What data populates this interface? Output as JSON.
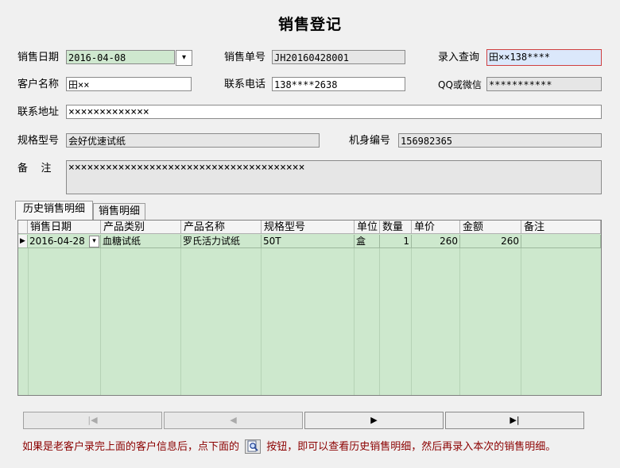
{
  "title": "销售登记",
  "form": {
    "sale_date": {
      "label": "销售日期",
      "value": "2016-04-08"
    },
    "sale_no": {
      "label": "销售单号",
      "value": "JH20160428001"
    },
    "lookup": {
      "label": "录入查询",
      "value": "田××138****"
    },
    "customer": {
      "label": "客户名称",
      "value": "田××"
    },
    "phone": {
      "label": "联系电话",
      "value": "138****2638"
    },
    "qq": {
      "label": "QQ或微信",
      "value": "***********"
    },
    "address": {
      "label": "联系地址",
      "value": "×××××××××××××"
    },
    "model": {
      "label": "规格型号",
      "value": "会好优速试纸"
    },
    "serial": {
      "label": "机身编号",
      "value": "156982365"
    },
    "note": {
      "label": "备    注",
      "value": "××××××××××××××××××××××××××××××××××××××"
    }
  },
  "tabs": [
    {
      "label": "历史销售明细",
      "active": true
    },
    {
      "label": "销售明细",
      "active": false
    }
  ],
  "grid": {
    "columns": [
      "销售日期",
      "产品类别",
      "产品名称",
      "规格型号",
      "单位",
      "数量",
      "单价",
      "金额",
      "备注"
    ],
    "rows": [
      {
        "date": "2016-04-28",
        "category": "血糖试纸",
        "product": "罗氏活力试纸",
        "spec": "50T",
        "unit": "盒",
        "qty": "1",
        "price": "260",
        "amount": "260",
        "remark": ""
      }
    ]
  },
  "nav": {
    "first": "|◀",
    "prev": "◀",
    "next": "▶",
    "last": "▶|"
  },
  "hint": {
    "before": "如果是老客户录完上面的客户信息后，点下面的",
    "after": "按钮，即可以查看历史销售明细，然后再录入本次的销售明细。"
  },
  "colors": {
    "grid_bg": "#cde8cd",
    "hint_text": "#8b0000",
    "focus_border": "#d04040"
  }
}
